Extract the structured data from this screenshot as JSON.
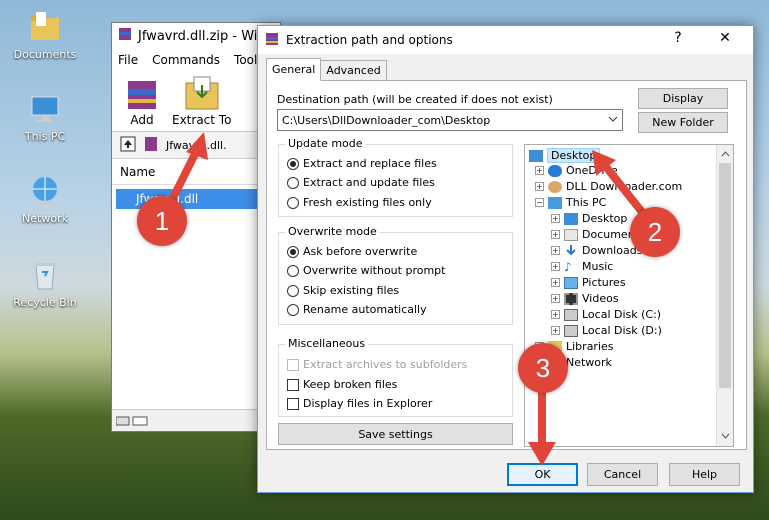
{
  "desktop": {
    "icons": [
      {
        "label": "Documents"
      },
      {
        "label": "This PC"
      },
      {
        "label": "Network"
      },
      {
        "label": "Recycle Bin"
      }
    ]
  },
  "rar_window": {
    "title": "Jfwavrd.dll.zip - Win",
    "menu": [
      "File",
      "Commands",
      "Tools"
    ],
    "toolbar": {
      "add": "Add",
      "extract_to": "Extract To"
    },
    "address": "Jfwavrd.dll.",
    "column_name": "Name",
    "file_row": "Jfwavrd.dll"
  },
  "dialog": {
    "title": "Extraction path and options",
    "help_glyph": "?",
    "close_glyph": "✕",
    "tabs": [
      "General",
      "Advanced"
    ],
    "dest_label": "Destination path (will be created if does not exist)",
    "dest_value": "C:\\Users\\DllDownloader_com\\Desktop",
    "display_btn": "Display",
    "new_folder_btn": "New Folder",
    "update_mode": {
      "title": "Update mode",
      "options": [
        "Extract and replace files",
        "Extract and update files",
        "Fresh existing files only"
      ],
      "selected": 0
    },
    "overwrite_mode": {
      "title": "Overwrite mode",
      "options": [
        "Ask before overwrite",
        "Overwrite without prompt",
        "Skip existing files",
        "Rename automatically"
      ],
      "selected": 0
    },
    "misc": {
      "title": "Miscellaneous",
      "options": [
        "Extract archives to subfolders",
        "Keep broken files",
        "Display files in Explorer"
      ]
    },
    "save_settings": "Save settings",
    "tree": [
      "Desktop",
      "OneDrive",
      "DLL Downloader.com",
      "This PC",
      "Desktop",
      "Documents",
      "Downloads",
      "Music",
      "Pictures",
      "Videos",
      "Local Disk (C:)",
      "Local Disk (D:)",
      "Libraries",
      "Network"
    ],
    "ok": "OK",
    "cancel": "Cancel",
    "help": "Help"
  },
  "callouts": [
    "1",
    "2",
    "3"
  ],
  "colors": {
    "callout": "#e0453a",
    "selection": "#3d8ee8"
  }
}
